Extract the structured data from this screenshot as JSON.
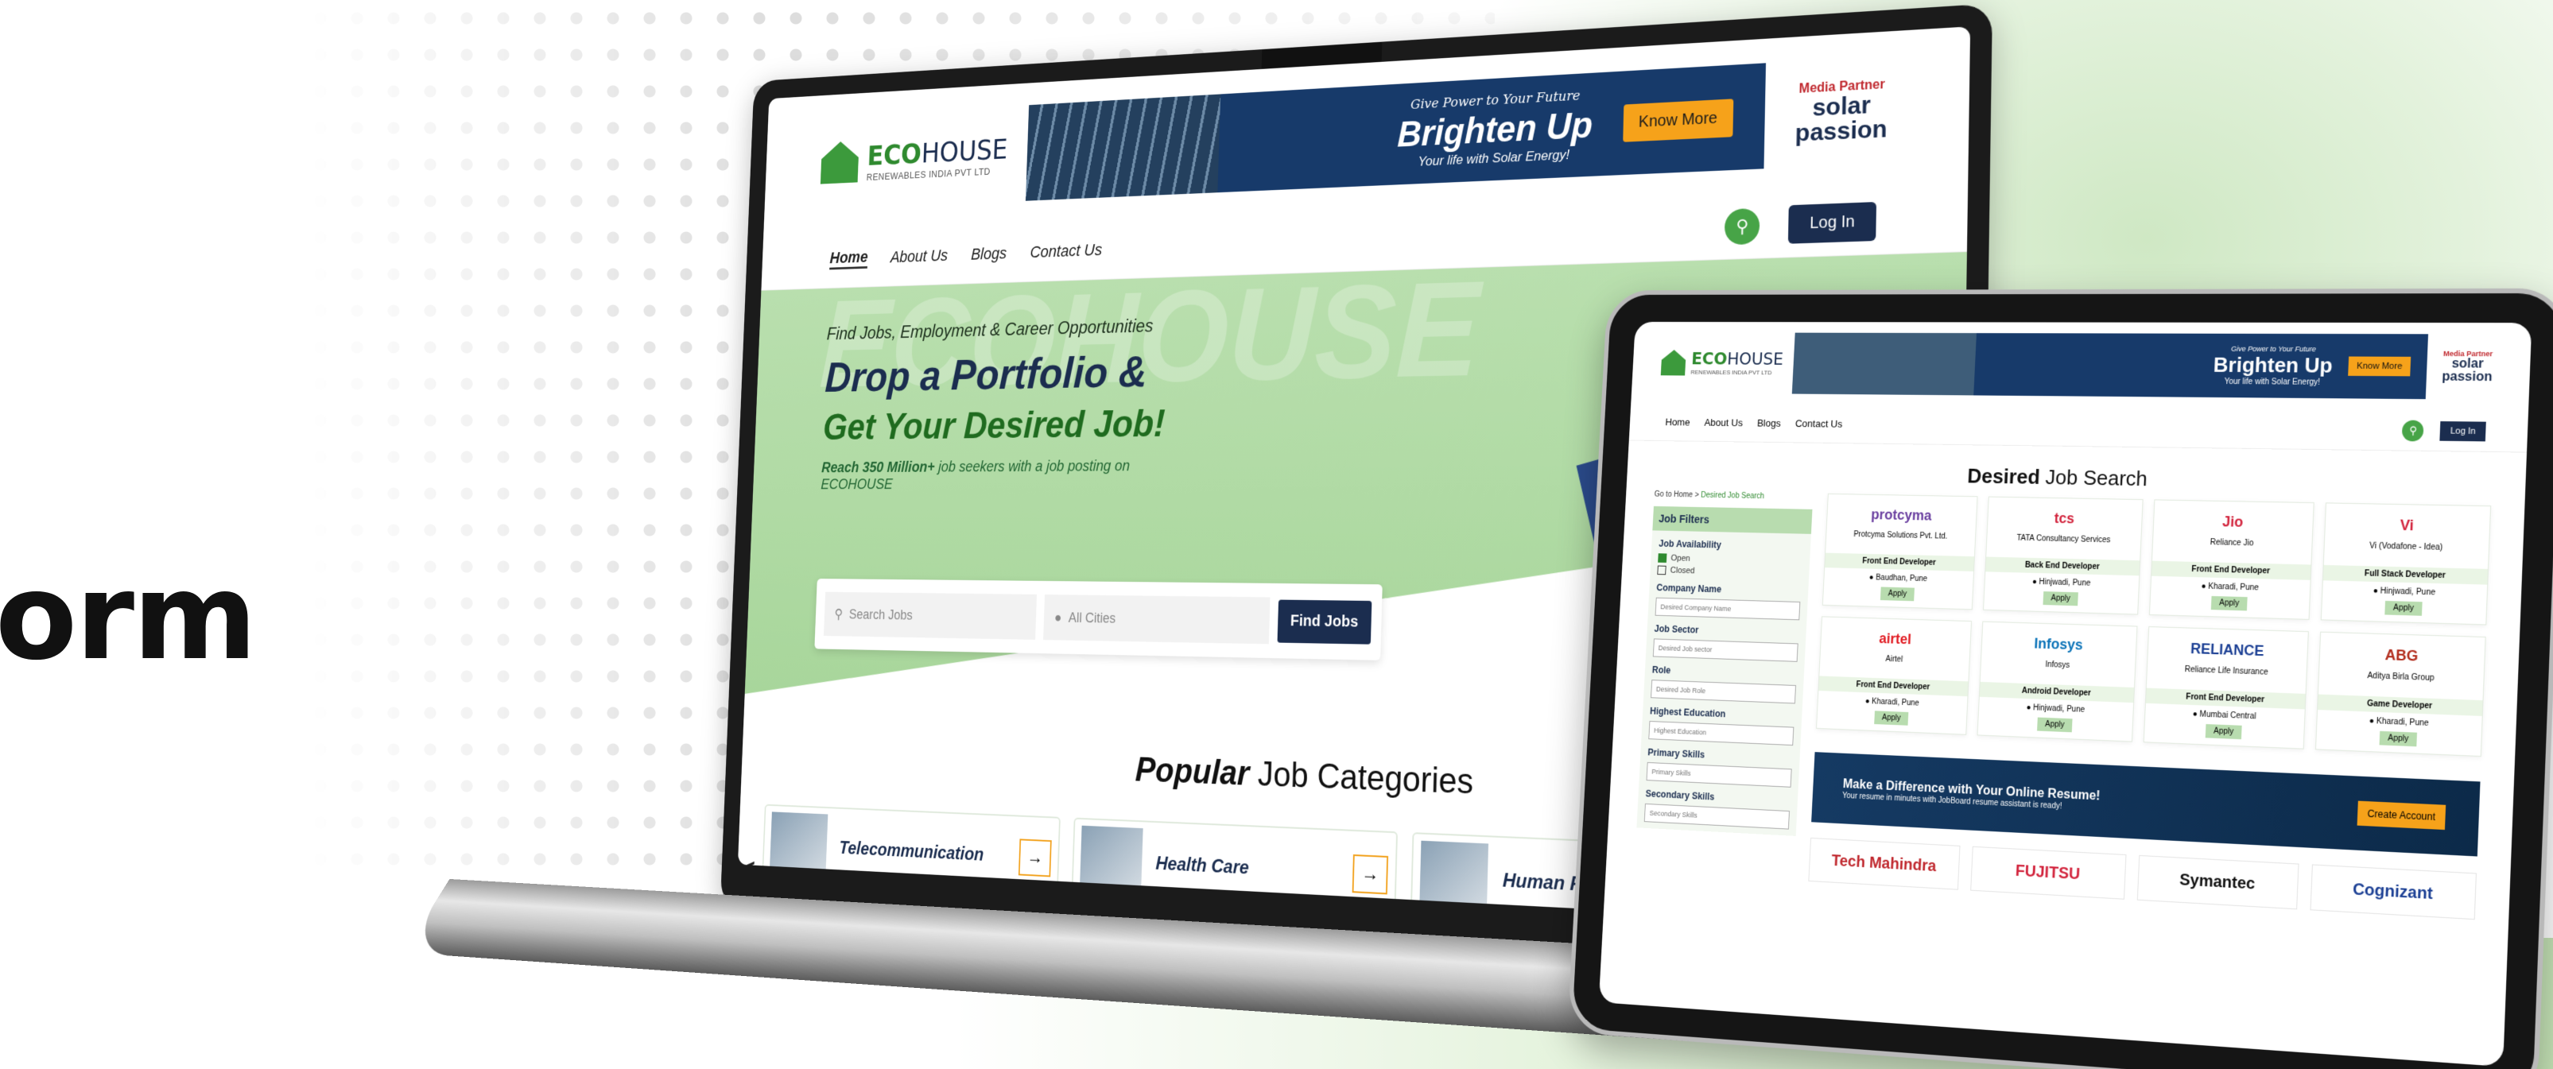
{
  "hero_fragment": "orm",
  "laptop": {
    "logo": {
      "brand_bold": "ECO",
      "brand_rest": "HOUSE",
      "sub": "RENEWABLES INDIA PVT LTD"
    },
    "banner": {
      "tagline": "Give Power to Your Future",
      "headline": "Brighten Up",
      "sub": "Your life with Solar Energy!",
      "cta": "Know More"
    },
    "media": {
      "label": "Media Partner",
      "name_line1": "solar",
      "name_line2": "passion"
    },
    "nav": {
      "items": [
        "Home",
        "About Us",
        "Blogs",
        "Contact Us"
      ],
      "login": "Log In"
    },
    "hero": {
      "watermark": "ECOHOUSE",
      "kicker": "Find Jobs, Employment & Career Opportunities",
      "title1": "Drop a Portfolio &",
      "title2": "Get Your Desired Job!",
      "desc_bold": "Reach 350 Million+",
      "desc": " job seekers with a job posting on ECOHOUSE"
    },
    "search": {
      "jobs_placeholder": "Search Jobs",
      "city_placeholder": "All Cities",
      "button": "Find Jobs"
    },
    "categories": {
      "title_bold": "Popular",
      "title_rest": " Job Categories",
      "items": [
        "Telecommunication",
        "Health Care",
        "Human Resource"
      ],
      "prev": "<"
    }
  },
  "tablet": {
    "logo": {
      "brand_bold": "ECO",
      "brand_rest": "HOUSE",
      "sub": "RENEWABLES INDIA PVT LTD"
    },
    "banner": {
      "tagline": "Give Power to Your Future",
      "headline": "Brighten Up",
      "sub": "Your life with Solar Energy!",
      "cta": "Know More"
    },
    "media": {
      "label": "Media Partner",
      "name_line1": "solar",
      "name_line2": "passion"
    },
    "nav": {
      "items": [
        "Home",
        "About Us",
        "Blogs",
        "Contact Us"
      ],
      "login": "Log In"
    },
    "title_bold": "Desired",
    "title_rest": " Job Search",
    "breadcrumb": {
      "home": "Go to Home",
      "sep": " > ",
      "current": "Desired Job Search"
    },
    "filters": {
      "header": "Job Filters",
      "availability": "Job Availability",
      "open": "Open",
      "closed": "Closed",
      "company": "Company Name",
      "company_ph": "Desired Company Name",
      "sector": "Job Sector",
      "sector_ph": "Desired Job sector",
      "role": "Role",
      "role_ph": "Desired Job Role",
      "education": "Highest Education",
      "education_ph": "Highest Education",
      "primary": "Primary Skills",
      "primary_ph": "Primary Skills",
      "secondary": "Secondary Skills",
      "secondary_ph": "Secondary Skills"
    },
    "jobs": [
      {
        "logo": "protcyma",
        "company": "Protcyma Solutions Pvt. Ltd.",
        "role": "Front End Developer",
        "loc": "Baudhan, Pune",
        "apply": "Apply",
        "color": "#6a3fa0"
      },
      {
        "logo": "tcs",
        "company": "TATA Consultancy Services",
        "role": "Back End Developer",
        "loc": "Hinjwadi, Pune",
        "apply": "Apply",
        "color": "#d2233c"
      },
      {
        "logo": "Jio",
        "company": "Reliance Jio",
        "role": "Front End Developer",
        "loc": "Kharadi, Pune",
        "apply": "Apply",
        "color": "#d2233c"
      },
      {
        "logo": "Vi",
        "company": "Vi (Vodafone - Idea)",
        "role": "Full Stack Developer",
        "loc": "Hinjwadi, Pune",
        "apply": "Apply",
        "color": "#d2233c"
      },
      {
        "logo": "airtel",
        "company": "Airtel",
        "role": "Front End Developer",
        "loc": "Kharadi, Pune",
        "apply": "Apply",
        "color": "#e11b22"
      },
      {
        "logo": "Infosys",
        "company": "Infosys",
        "role": "Android Developer",
        "loc": "Hinjwadi, Pune",
        "apply": "Apply",
        "color": "#0b73b8"
      },
      {
        "logo": "RELIANCE",
        "company": "Reliance Life Insurance",
        "role": "Front End Developer",
        "loc": "Mumbai Central",
        "apply": "Apply",
        "color": "#1b3f94"
      },
      {
        "logo": "ABG",
        "company": "Aditya Birla Group",
        "role": "Game Developer",
        "loc": "Kharadi, Pune",
        "apply": "Apply",
        "color": "#b22c1c"
      }
    ],
    "resume": {
      "heading": "Make a Difference with Your Online Resume!",
      "sub": "Your resume in minutes with JobBoard resume assistant is ready!",
      "cta": "Create Account"
    },
    "brands": [
      "Tech Mahindra",
      "FUJITSU",
      "Symantec",
      "Cognizant"
    ]
  }
}
